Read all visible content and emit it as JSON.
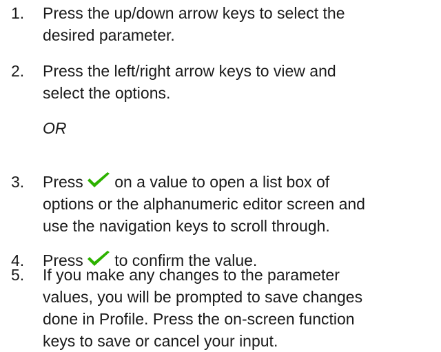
{
  "steps": [
    {
      "number": "1.",
      "lines": [
        "Press the up/down arrow keys to select the",
        "desired parameter."
      ]
    },
    {
      "number": "2.",
      "lines": [
        "Press the left/right arrow keys to view and",
        "select the options."
      ]
    },
    {
      "number": "3.",
      "before_icon": "Press",
      "after_icon": "on a value to open a list box of",
      "lines": [
        "options or the alphanumeric editor screen and",
        "use the navigation keys to scroll through."
      ]
    },
    {
      "number": "4.",
      "before_icon": "Press",
      "after_icon": "to confirm the value."
    },
    {
      "number": "5.",
      "lines": [
        "If you make any changes to the parameter",
        "values, you will be prompted to save changes",
        "done in Profile. Press the on-screen function",
        "keys to save or cancel your input."
      ]
    }
  ],
  "or_label": "OR",
  "icons": {
    "confirm": "checkmark-icon",
    "confirm_color": "#2db200"
  }
}
